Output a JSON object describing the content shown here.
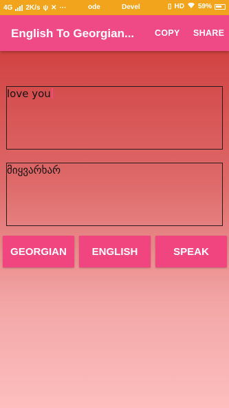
{
  "status_bar": {
    "network": "4G",
    "speed": "2K/s",
    "mode_text": "ode",
    "dev_text": "Devel",
    "hd_text": "HD",
    "battery": "59%"
  },
  "app_bar": {
    "title": "English To Georgian...",
    "copy_label": "COPY",
    "share_label": "SHARE"
  },
  "input": {
    "value": "love you"
  },
  "output": {
    "value": "მიყვარხარ"
  },
  "buttons": {
    "georgian_label": "GEORGIAN",
    "english_label": "ENGLISH",
    "speak_label": "SPEAK"
  },
  "colors": {
    "status_bar": "#f2a51c",
    "app_bar": "#ef4a86",
    "button": "#f1457f",
    "gradient_top": "#cc3333",
    "gradient_bottom": "#fdbebe"
  }
}
